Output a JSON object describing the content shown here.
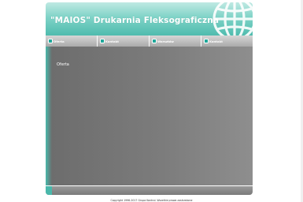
{
  "header": {
    "title": "\"MAIOS\" Drukarnia Fleksograficzna",
    "logo_icon": "globe-icon"
  },
  "nav": {
    "items": [
      {
        "label": "Oferta"
      },
      {
        "label": "Kontakt"
      },
      {
        "label": "Warsztów"
      },
      {
        "label": "Kontakt"
      }
    ]
  },
  "main": {
    "text": "Oferta"
  },
  "footer": {
    "copyright": "Copyright 1996-2017 Grupa Kontrol. Wszelkie prawa zastrzeżone"
  },
  "colors": {
    "accent": "#4fbcae",
    "nav_bullet": "#1fa79a",
    "content_bg": "#7a7a7a"
  }
}
